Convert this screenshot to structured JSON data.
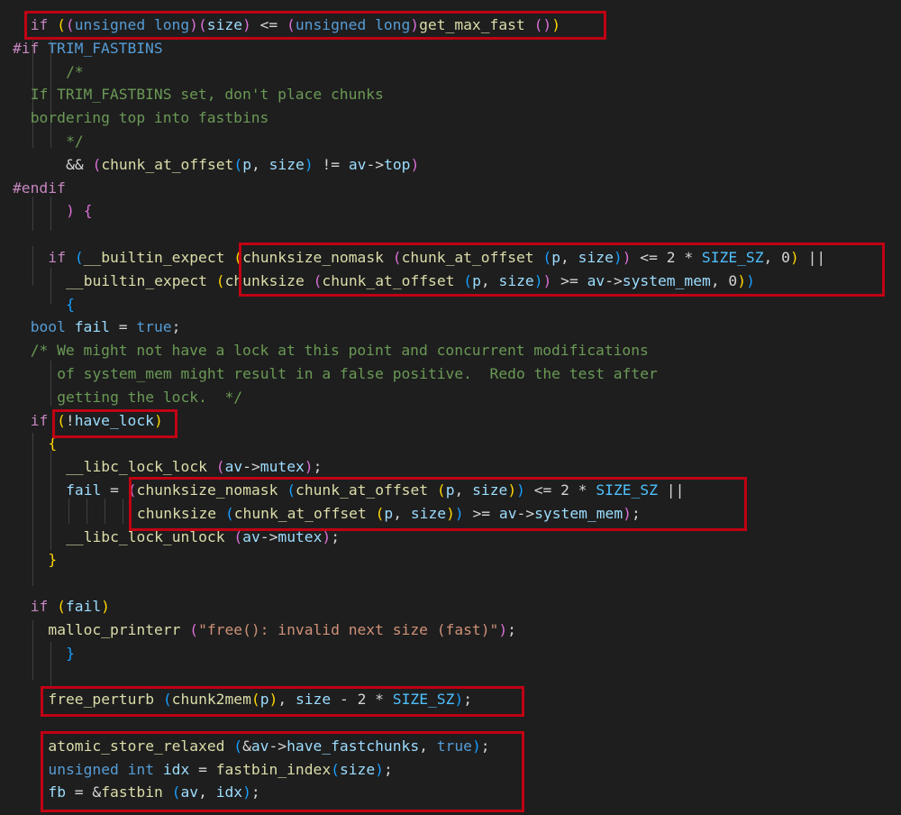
{
  "lines": [
    {
      "indent": 2,
      "tokens": [
        [
          "ctl",
          "if"
        ],
        [
          "plain",
          " "
        ],
        [
          "b1",
          "("
        ],
        [
          "b2",
          "("
        ],
        [
          "kw",
          "unsigned long"
        ],
        [
          "b2",
          ")"
        ],
        [
          "b2",
          "("
        ],
        [
          "var",
          "size"
        ],
        [
          "b2",
          ")"
        ],
        [
          "plain",
          " <= "
        ],
        [
          "b2",
          "("
        ],
        [
          "kw",
          "unsigned long"
        ],
        [
          "b2",
          ")"
        ],
        [
          "fn",
          "get_max_fast"
        ],
        [
          "plain",
          " "
        ],
        [
          "b2",
          "("
        ],
        [
          "b2",
          ")"
        ],
        [
          "b1",
          ")"
        ]
      ]
    },
    {
      "indent": 0,
      "tokens": [
        [
          "ctl",
          "#if"
        ],
        [
          "plain",
          " "
        ],
        [
          "kw",
          "TRIM_FASTBINS"
        ]
      ]
    },
    {
      "indent": 6,
      "tokens": [
        [
          "cmt",
          "/*"
        ]
      ]
    },
    {
      "indent": 2,
      "tokens": [
        [
          "cmt",
          "If TRIM_FASTBINS set, don't place chunks"
        ]
      ]
    },
    {
      "indent": 2,
      "tokens": [
        [
          "cmt",
          "bordering top into fastbins"
        ]
      ]
    },
    {
      "indent": 6,
      "tokens": [
        [
          "cmt",
          "*/"
        ]
      ]
    },
    {
      "indent": 6,
      "tokens": [
        [
          "plain",
          "&& "
        ],
        [
          "b2",
          "("
        ],
        [
          "fn",
          "chunk_at_offset"
        ],
        [
          "b3",
          "("
        ],
        [
          "var",
          "p"
        ],
        [
          "plain",
          ", "
        ],
        [
          "var",
          "size"
        ],
        [
          "b3",
          ")"
        ],
        [
          "plain",
          " != "
        ],
        [
          "var",
          "av"
        ],
        [
          "plain",
          "->"
        ],
        [
          "var",
          "top"
        ],
        [
          "b2",
          ")"
        ]
      ]
    },
    {
      "indent": 0,
      "tokens": [
        [
          "ctl",
          "#endif"
        ]
      ]
    },
    {
      "indent": 6,
      "tokens": [
        [
          "b2",
          ")"
        ],
        [
          "plain",
          " "
        ],
        [
          "b2",
          "{"
        ]
      ]
    },
    {
      "indent": 0,
      "tokens": []
    },
    {
      "indent": 4,
      "tokens": [
        [
          "ctl",
          "if"
        ],
        [
          "plain",
          " "
        ],
        [
          "b3",
          "("
        ],
        [
          "fn",
          "__builtin_expect"
        ],
        [
          "plain",
          " "
        ],
        [
          "b1",
          "("
        ],
        [
          "fn",
          "chunksize_nomask"
        ],
        [
          "plain",
          " "
        ],
        [
          "b2",
          "("
        ],
        [
          "fn",
          "chunk_at_offset"
        ],
        [
          "plain",
          " "
        ],
        [
          "b3",
          "("
        ],
        [
          "var",
          "p"
        ],
        [
          "plain",
          ", "
        ],
        [
          "var",
          "size"
        ],
        [
          "b3",
          ")"
        ],
        [
          "b2",
          ")"
        ],
        [
          "plain",
          " <= 2 * "
        ],
        [
          "mac",
          "SIZE_SZ"
        ],
        [
          "plain",
          ", 0"
        ],
        [
          "b1",
          ")"
        ],
        [
          "plain",
          " ||"
        ]
      ]
    },
    {
      "indent": 6,
      "tokens": [
        [
          "fn",
          "__builtin_expect"
        ],
        [
          "plain",
          " "
        ],
        [
          "b1",
          "("
        ],
        [
          "fn",
          "chunksize"
        ],
        [
          "plain",
          " "
        ],
        [
          "b2",
          "("
        ],
        [
          "fn",
          "chunk_at_offset"
        ],
        [
          "plain",
          " "
        ],
        [
          "b3",
          "("
        ],
        [
          "var",
          "p"
        ],
        [
          "plain",
          ", "
        ],
        [
          "var",
          "size"
        ],
        [
          "b3",
          ")"
        ],
        [
          "b2",
          ")"
        ],
        [
          "plain",
          " >= "
        ],
        [
          "var",
          "av"
        ],
        [
          "plain",
          "->"
        ],
        [
          "var",
          "system_mem"
        ],
        [
          "plain",
          ", 0"
        ],
        [
          "b1",
          ")"
        ],
        [
          "b3",
          ")"
        ]
      ]
    },
    {
      "indent": 6,
      "tokens": [
        [
          "b3",
          "{"
        ]
      ]
    },
    {
      "indent": 2,
      "tokens": [
        [
          "kw",
          "bool"
        ],
        [
          "plain",
          " "
        ],
        [
          "var",
          "fail"
        ],
        [
          "plain",
          " = "
        ],
        [
          "kw",
          "true"
        ],
        [
          "plain",
          ";"
        ]
      ]
    },
    {
      "indent": 2,
      "tokens": [
        [
          "cmt",
          "/* We might not have a lock at this point and concurrent modifications"
        ]
      ]
    },
    {
      "indent": 5,
      "tokens": [
        [
          "cmt",
          "of system_mem might result in a false positive.  Redo the test after"
        ]
      ]
    },
    {
      "indent": 5,
      "tokens": [
        [
          "cmt",
          "getting the lock.  */"
        ]
      ]
    },
    {
      "indent": 2,
      "tokens": [
        [
          "ctl",
          "if"
        ],
        [
          "plain",
          " "
        ],
        [
          "b1",
          "("
        ],
        [
          "plain",
          "!"
        ],
        [
          "var",
          "have_lock"
        ],
        [
          "b1",
          ")"
        ]
      ]
    },
    {
      "indent": 4,
      "tokens": [
        [
          "b1",
          "{"
        ]
      ]
    },
    {
      "indent": 6,
      "tokens": [
        [
          "fn",
          "__libc_lock_lock"
        ],
        [
          "plain",
          " "
        ],
        [
          "b2",
          "("
        ],
        [
          "var",
          "av"
        ],
        [
          "plain",
          "->"
        ],
        [
          "var",
          "mutex"
        ],
        [
          "b2",
          ")"
        ],
        [
          "plain",
          ";"
        ]
      ]
    },
    {
      "indent": 6,
      "tokens": [
        [
          "var",
          "fail"
        ],
        [
          "plain",
          " = "
        ],
        [
          "b2",
          "("
        ],
        [
          "fn",
          "chunksize_nomask"
        ],
        [
          "plain",
          " "
        ],
        [
          "b3",
          "("
        ],
        [
          "fn",
          "chunk_at_offset"
        ],
        [
          "plain",
          " "
        ],
        [
          "b1",
          "("
        ],
        [
          "var",
          "p"
        ],
        [
          "plain",
          ", "
        ],
        [
          "var",
          "size"
        ],
        [
          "b1",
          ")"
        ],
        [
          "b3",
          ")"
        ],
        [
          "plain",
          " <= 2 * "
        ],
        [
          "mac",
          "SIZE_SZ"
        ],
        [
          "plain",
          " ||"
        ]
      ]
    },
    {
      "indent": 14,
      "tokens": [
        [
          "fn",
          "chunksize"
        ],
        [
          "plain",
          " "
        ],
        [
          "b3",
          "("
        ],
        [
          "fn",
          "chunk_at_offset"
        ],
        [
          "plain",
          " "
        ],
        [
          "b1",
          "("
        ],
        [
          "var",
          "p"
        ],
        [
          "plain",
          ", "
        ],
        [
          "var",
          "size"
        ],
        [
          "b1",
          ")"
        ],
        [
          "b3",
          ")"
        ],
        [
          "plain",
          " >= "
        ],
        [
          "var",
          "av"
        ],
        [
          "plain",
          "->"
        ],
        [
          "var",
          "system_mem"
        ],
        [
          "b2",
          ")"
        ],
        [
          "plain",
          ";"
        ]
      ]
    },
    {
      "indent": 6,
      "tokens": [
        [
          "fn",
          "__libc_lock_unlock"
        ],
        [
          "plain",
          " "
        ],
        [
          "b2",
          "("
        ],
        [
          "var",
          "av"
        ],
        [
          "plain",
          "->"
        ],
        [
          "var",
          "mutex"
        ],
        [
          "b2",
          ")"
        ],
        [
          "plain",
          ";"
        ]
      ]
    },
    {
      "indent": 4,
      "tokens": [
        [
          "b1",
          "}"
        ]
      ]
    },
    {
      "indent": 0,
      "tokens": []
    },
    {
      "indent": 2,
      "tokens": [
        [
          "ctl",
          "if"
        ],
        [
          "plain",
          " "
        ],
        [
          "b1",
          "("
        ],
        [
          "var",
          "fail"
        ],
        [
          "b1",
          ")"
        ]
      ]
    },
    {
      "indent": 4,
      "tokens": [
        [
          "fn",
          "malloc_printerr"
        ],
        [
          "plain",
          " "
        ],
        [
          "b2",
          "("
        ],
        [
          "str",
          "\"free(): invalid next size (fast)\""
        ],
        [
          "b2",
          ")"
        ],
        [
          "plain",
          ";"
        ]
      ]
    },
    {
      "indent": 6,
      "tokens": [
        [
          "b3",
          "}"
        ]
      ]
    },
    {
      "indent": 0,
      "tokens": []
    },
    {
      "indent": 4,
      "tokens": [
        [
          "fn",
          "free_perturb"
        ],
        [
          "plain",
          " "
        ],
        [
          "b3",
          "("
        ],
        [
          "fn",
          "chunk2mem"
        ],
        [
          "b1",
          "("
        ],
        [
          "var",
          "p"
        ],
        [
          "b1",
          ")"
        ],
        [
          "plain",
          ", "
        ],
        [
          "var",
          "size"
        ],
        [
          "plain",
          " - 2 * "
        ],
        [
          "mac",
          "SIZE_SZ"
        ],
        [
          "b3",
          ")"
        ],
        [
          "plain",
          ";"
        ]
      ]
    },
    {
      "indent": 0,
      "tokens": []
    },
    {
      "indent": 4,
      "tokens": [
        [
          "fn",
          "atomic_store_relaxed"
        ],
        [
          "plain",
          " "
        ],
        [
          "b3",
          "("
        ],
        [
          "plain",
          "&"
        ],
        [
          "var",
          "av"
        ],
        [
          "plain",
          "->"
        ],
        [
          "var",
          "have_fastchunks"
        ],
        [
          "plain",
          ", "
        ],
        [
          "kw",
          "true"
        ],
        [
          "b3",
          ")"
        ],
        [
          "plain",
          ";"
        ]
      ]
    },
    {
      "indent": 4,
      "tokens": [
        [
          "kw",
          "unsigned int"
        ],
        [
          "plain",
          " "
        ],
        [
          "var",
          "idx"
        ],
        [
          "plain",
          " = "
        ],
        [
          "fn",
          "fastbin_index"
        ],
        [
          "b3",
          "("
        ],
        [
          "var",
          "size"
        ],
        [
          "b3",
          ")"
        ],
        [
          "plain",
          ";"
        ]
      ]
    },
    {
      "indent": 4,
      "tokens": [
        [
          "var",
          "fb"
        ],
        [
          "plain",
          " = &"
        ],
        [
          "fn",
          "fastbin"
        ],
        [
          "plain",
          " "
        ],
        [
          "b3",
          "("
        ],
        [
          "var",
          "av"
        ],
        [
          "plain",
          ", "
        ],
        [
          "var",
          "idx"
        ],
        [
          "b3",
          ")"
        ],
        [
          "plain",
          ";"
        ]
      ]
    }
  ]
}
